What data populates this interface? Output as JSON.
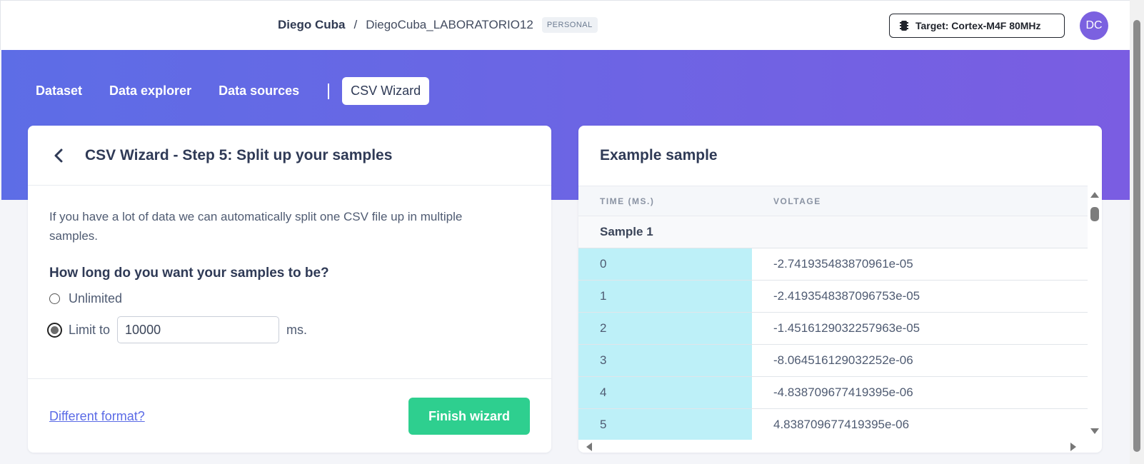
{
  "header": {
    "owner": "Diego Cuba",
    "separator": "/",
    "project": "DiegoCuba_LABORATORIO12",
    "badge": "PERSONAL",
    "target_label": "Target: Cortex-M4F 80MHz",
    "target_icon": "chip-icon",
    "avatar_initials": "DC"
  },
  "tabs": [
    {
      "label": "Dataset"
    },
    {
      "label": "Data explorer"
    },
    {
      "label": "Data sources"
    },
    {
      "label": "CSV Wizard",
      "active": true
    }
  ],
  "wizard": {
    "back_icon": "chevron-left-icon",
    "title": "CSV Wizard - Step 5: Split up your samples",
    "intro": "If you have a lot of data we can automatically split one CSV file up in multiple samples.",
    "question": "How long do you want your samples to be?",
    "option_unlimited": "Unlimited",
    "option_limit": "Limit to",
    "selected_option": "Limit to",
    "limit_value": "10000",
    "limit_unit": "ms.",
    "different_format_link": "Different format?",
    "finish_button": "Finish wizard"
  },
  "sample": {
    "title": "Example sample",
    "columns": [
      "TIME (MS.)",
      "VOLTAGE"
    ],
    "group_label": "Sample 1",
    "rows": [
      {
        "time": "0",
        "voltage": "-2.741935483870961e-05"
      },
      {
        "time": "1",
        "voltage": "-2.4193548387096753e-05"
      },
      {
        "time": "2",
        "voltage": "-1.4516129032257963e-05"
      },
      {
        "time": "3",
        "voltage": "-8.064516129032252e-06"
      },
      {
        "time": "4",
        "voltage": "-4.838709677419395e-06"
      },
      {
        "time": "5",
        "voltage": "4.838709677419395e-06"
      }
    ]
  },
  "colors": {
    "accent": "#6a66e4",
    "finish_button": "#2ecf8f",
    "time_cell": "#bdf0f8",
    "avatar": "#7b61e0"
  }
}
